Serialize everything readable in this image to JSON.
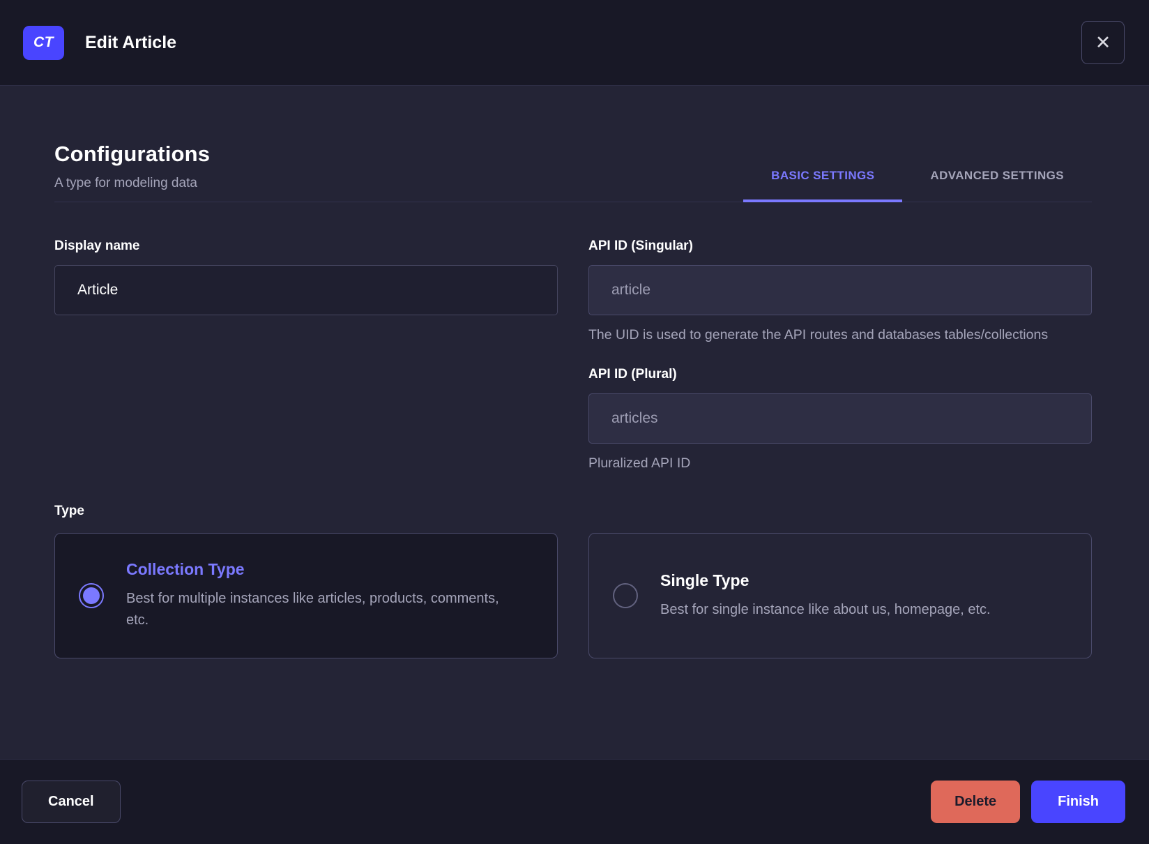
{
  "header": {
    "badge": "CT",
    "title": "Edit Article",
    "close_icon": "✕"
  },
  "main": {
    "heading": "Configurations",
    "subheading": "A type for modeling data",
    "tabs": [
      {
        "label": "BASIC SETTINGS",
        "active": true
      },
      {
        "label": "ADVANCED SETTINGS",
        "active": false
      }
    ],
    "fields": {
      "display_name": {
        "label": "Display name",
        "value": "Article"
      },
      "api_id_singular": {
        "label": "API ID (Singular)",
        "placeholder": "article",
        "hint": "The UID is used to generate the API routes and databases tables/collections"
      },
      "api_id_plural": {
        "label": "API ID (Plural)",
        "placeholder": "articles",
        "hint": "Pluralized API ID"
      }
    },
    "type": {
      "label": "Type",
      "options": [
        {
          "title": "Collection Type",
          "description": "Best for multiple instances like articles, products, comments, etc.",
          "selected": true
        },
        {
          "title": "Single Type",
          "description": "Best for single instance like about us, homepage, etc.",
          "selected": false
        }
      ]
    }
  },
  "footer": {
    "cancel_label": "Cancel",
    "delete_label": "Delete",
    "finish_label": "Finish"
  },
  "colors": {
    "primary": "#4945ff",
    "primary_light": "#7b79ff",
    "danger": "#df695a",
    "header_bg": "#181826",
    "body_bg": "#242436",
    "border": "#4a4a6a",
    "text_muted": "#a5a5ba"
  }
}
